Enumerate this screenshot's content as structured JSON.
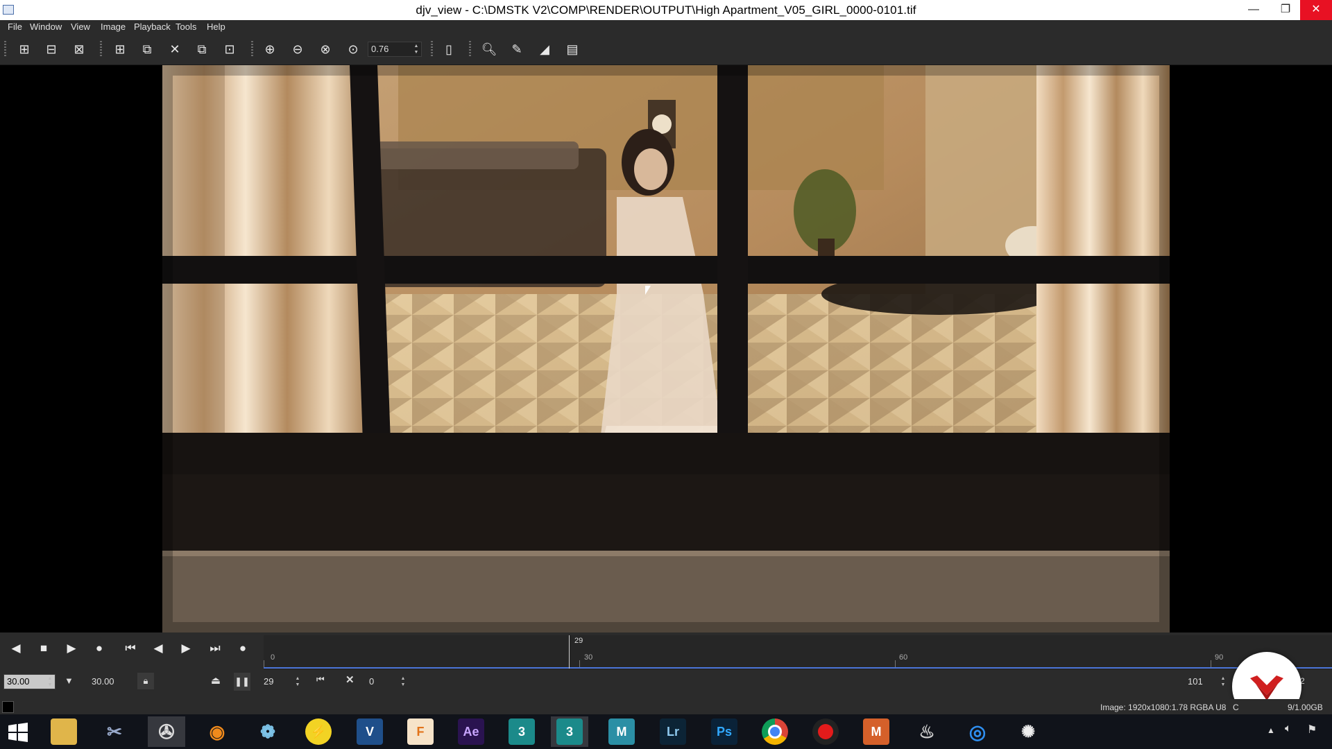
{
  "window": {
    "title": "djv_view - C:\\DMSTK V2\\COMP\\RENDER\\OUTPUT\\High Apartment_V05_GIRL_0000-0101.tif",
    "minimize": "—",
    "restore": "❐",
    "close": "✕"
  },
  "menu": {
    "items": [
      "File",
      "Window",
      "View",
      "Image",
      "Playback",
      "Tools",
      "Help"
    ]
  },
  "toolbar": {
    "zoom_value": "0.76"
  },
  "viewer": {
    "image_description": "rendered apartment interior seen through window"
  },
  "playback": {
    "current_frame_marker": "29",
    "ruler_labels": [
      "0",
      "30",
      "60",
      "90"
    ],
    "fps_value": "30.00",
    "fps_target": "30.00",
    "frame_field": "29",
    "in_point": "0",
    "end_frame": "101",
    "end_frame_trailing": "2"
  },
  "status": {
    "image_info": "Image: 1920x1080:1.78 RGBA U8",
    "cache_info": "9/1.00GB",
    "cache_prefix": "C"
  },
  "taskbar": {
    "apps": [
      {
        "name": "file-explorer",
        "label": ""
      },
      {
        "name": "snipping-tool",
        "label": ""
      },
      {
        "name": "djv-view",
        "label": ""
      },
      {
        "name": "blender",
        "label": ""
      },
      {
        "name": "davinci-resolve",
        "label": ""
      },
      {
        "name": "yellow-app",
        "label": ""
      },
      {
        "name": "vray",
        "label": "V"
      },
      {
        "name": "fusion",
        "label": "F"
      },
      {
        "name": "after-effects",
        "label": "Ae"
      },
      {
        "name": "3dsmax-1",
        "label": "3"
      },
      {
        "name": "3dsmax-2",
        "label": "3"
      },
      {
        "name": "maya",
        "label": "M"
      },
      {
        "name": "lightroom",
        "label": "Lr"
      },
      {
        "name": "photoshop",
        "label": "Ps"
      },
      {
        "name": "chrome",
        "label": ""
      },
      {
        "name": "obs-record",
        "label": ""
      },
      {
        "name": "mari",
        "label": "M"
      },
      {
        "name": "houdini",
        "label": ""
      },
      {
        "name": "quicktime",
        "label": ""
      },
      {
        "name": "misc-tool",
        "label": ""
      }
    ]
  },
  "colors": {
    "accent_blue": "#4a74d8",
    "ui_dark": "#2b2b2b",
    "badge_red": "#d01f1f"
  }
}
